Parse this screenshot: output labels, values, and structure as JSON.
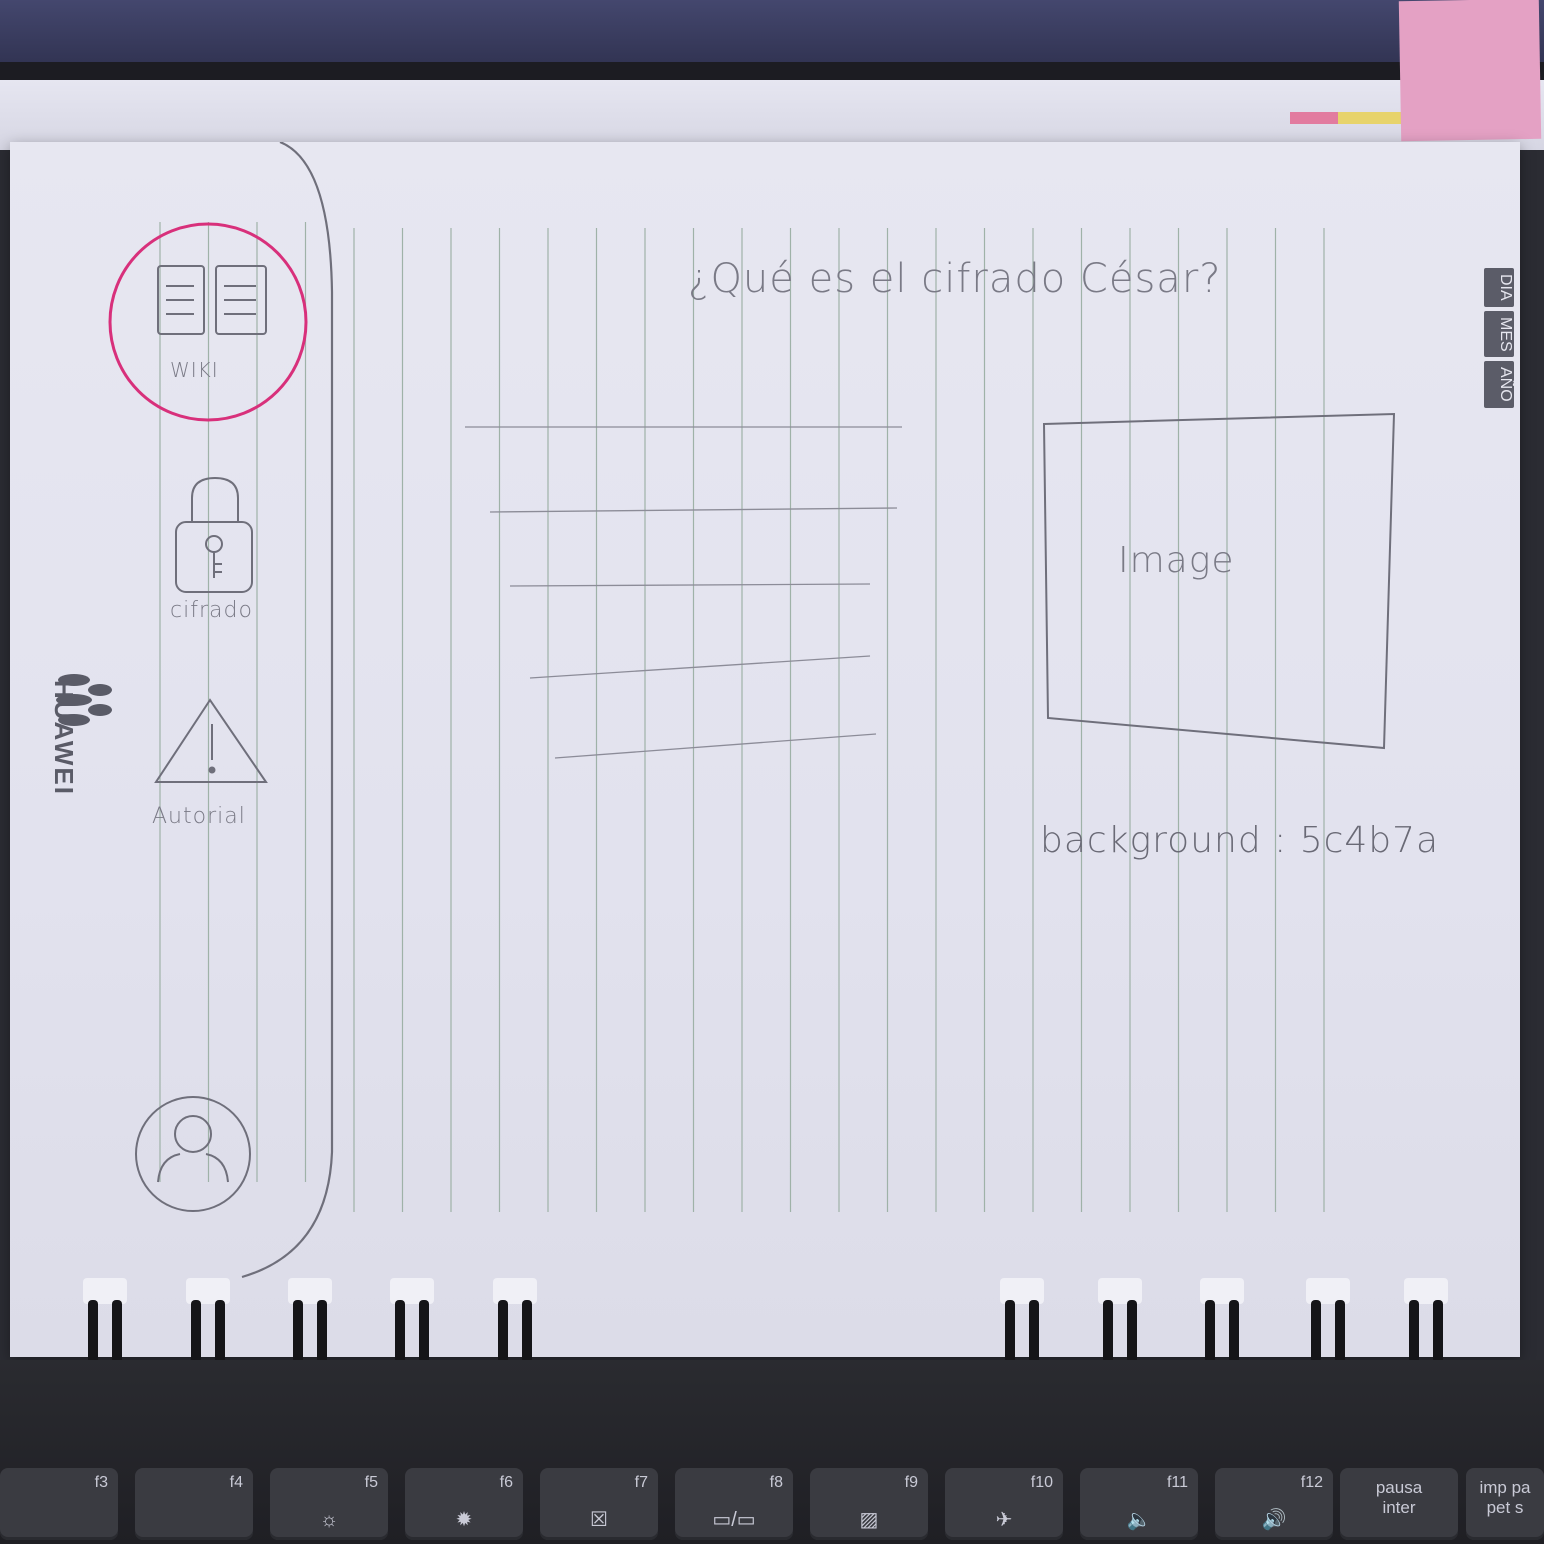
{
  "sketch": {
    "title": "¿Qué es el cifrado César?",
    "image_placeholder": "Image",
    "background_note": "background : 5c4b7a",
    "sidebar": {
      "items": [
        {
          "label": "WIKI",
          "icon": "book-icon",
          "highlighted": true
        },
        {
          "label": "cifrado",
          "icon": "padlock-key-icon"
        },
        {
          "label": "Autorial",
          "icon": "warning-icon"
        }
      ],
      "profile_icon": "user-icon"
    },
    "colors": {
      "paper": "#e4e4ef",
      "pencil": "#7a7a86",
      "highlight": "#d8307b",
      "rule_lines": "#8fa39a"
    }
  },
  "notebook": {
    "brand": "HUAWEI",
    "calendar_tabs": [
      "DIA",
      "MES",
      "AÑO"
    ]
  },
  "keyboard": {
    "keys": [
      {
        "fn": "f3",
        "symbol": ""
      },
      {
        "fn": "f4",
        "symbol": ""
      },
      {
        "fn": "f5",
        "symbol": "☼"
      },
      {
        "fn": "f6",
        "symbol": "✹"
      },
      {
        "fn": "f7",
        "symbol": "☒"
      },
      {
        "fn": "f8",
        "symbol": "▭/▭"
      },
      {
        "fn": "f9",
        "symbol": "▨"
      },
      {
        "fn": "f10",
        "symbol": "✈"
      },
      {
        "fn": "f11",
        "symbol": "🔈"
      },
      {
        "fn": "f12",
        "symbol": "🔊"
      }
    ],
    "pause_key": {
      "line1": "pausa",
      "line2": "inter"
    },
    "print_key": {
      "line1": "imp pa",
      "line2": "pet s"
    }
  }
}
